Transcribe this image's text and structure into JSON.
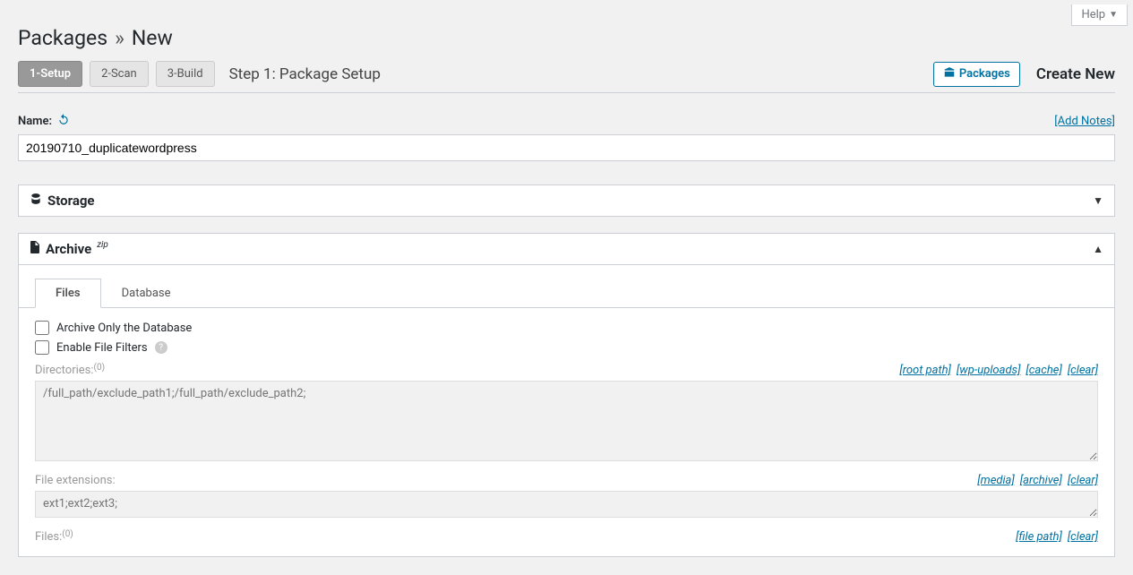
{
  "help": {
    "label": "Help"
  },
  "page": {
    "title_left": "Packages",
    "sep": "»",
    "title_right": "New"
  },
  "steps": {
    "s1": "1-Setup",
    "s2": "2-Scan",
    "s3": "3-Build",
    "title": "Step 1: Package Setup"
  },
  "packages_btn": "Packages",
  "create_new": "Create New",
  "name_section": {
    "label": "Name:",
    "add_notes": "[Add Notes]",
    "value": "20190710_duplicatewordpress"
  },
  "storage": {
    "title": "Storage"
  },
  "archive": {
    "title": "Archive",
    "sup": "zip",
    "tabs": {
      "files": "Files",
      "database": "Database"
    },
    "checkbox1": "Archive Only the Database",
    "checkbox2": "Enable File Filters",
    "directories": {
      "label": "Directories:",
      "count": "(0)",
      "links": {
        "root": "[root path]",
        "wp": "[wp-uploads]",
        "cache": "[cache]",
        "clear": "[clear]"
      },
      "placeholder": "/full_path/exclude_path1;/full_path/exclude_path2;"
    },
    "extensions": {
      "label": "File extensions:",
      "links": {
        "media": "[media]",
        "archive": "[archive]",
        "clear": "[clear]"
      },
      "placeholder": "ext1;ext2;ext3;"
    },
    "files": {
      "label": "Files:",
      "count": "(0)",
      "links": {
        "file": "[file path]",
        "clear": "[clear]"
      }
    }
  }
}
